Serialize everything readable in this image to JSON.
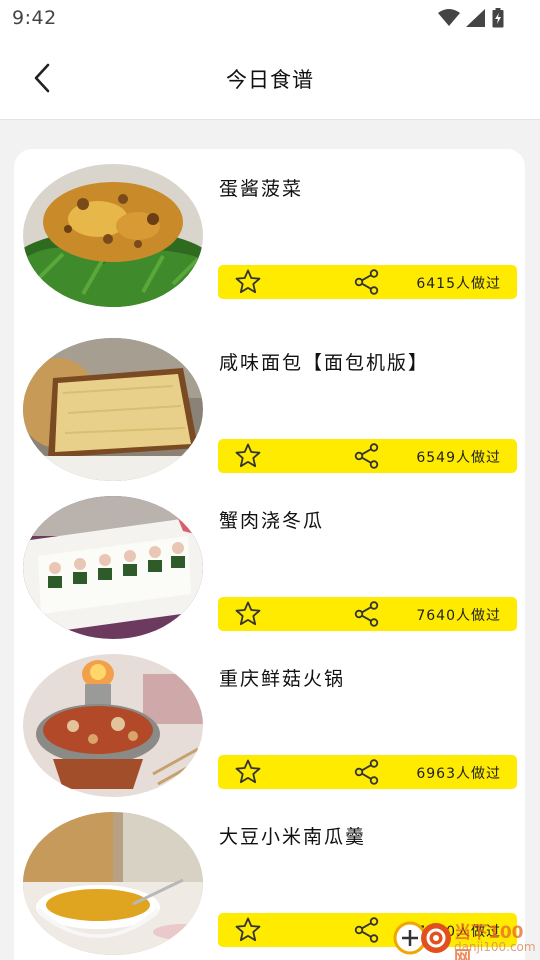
{
  "status_bar": {
    "time": "9:42"
  },
  "header": {
    "title": "今日食谱"
  },
  "recipes": [
    {
      "name": "蛋酱菠菜",
      "made_count": "6415人做过"
    },
    {
      "name": "咸味面包【面包机版】",
      "made_count": "6549人做过"
    },
    {
      "name": "蟹肉浇冬瓜",
      "made_count": "7640人做过"
    },
    {
      "name": "重庆鲜菇火锅",
      "made_count": "6963人做过"
    },
    {
      "name": "大豆小米南瓜羹",
      "made_count": "7020人做过"
    }
  ],
  "icons": {
    "favorite": "star-outline-icon",
    "share": "share-icon",
    "back": "chevron-left-icon"
  },
  "colors": {
    "accent": "#ffeb00",
    "icon": "#333333"
  },
  "watermark": {
    "text": "当下100网",
    "sub": "danji100.com"
  }
}
